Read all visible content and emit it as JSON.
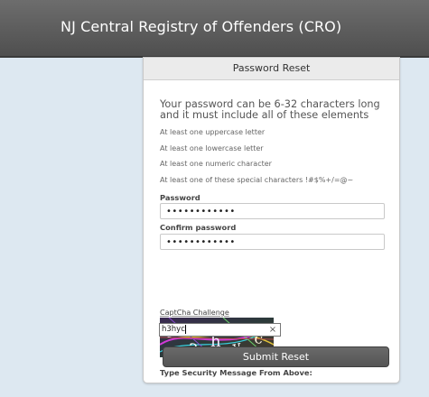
{
  "header": {
    "title": "NJ Central Registry of Offenders (CRO)"
  },
  "card": {
    "title": "Password Reset",
    "intro": "Your password can be 6-32 characters long and it must include all of these elements",
    "requirements": [
      "At least one uppercase letter",
      "At least one lowercase letter",
      "At least one numeric character",
      "At least one of these special characters !#$%+/=@~"
    ],
    "password_label": "Password",
    "password_value": "••••••••••••",
    "confirm_label": "Confirm password",
    "confirm_value": "••••••••••••",
    "captcha_label": "CaptCha Challenge",
    "captcha_chars": [
      "h",
      "3",
      "h",
      "y",
      "c"
    ],
    "security_label": "Type Security Message From Above:",
    "security_value": "h3hyc",
    "clear_glyph": "×",
    "submit_label": "Submit Reset"
  },
  "colors": {
    "header_bg": "#5e5e5e",
    "page_bg": "#dfe9f2",
    "button_bg": "#5e5e5e"
  }
}
